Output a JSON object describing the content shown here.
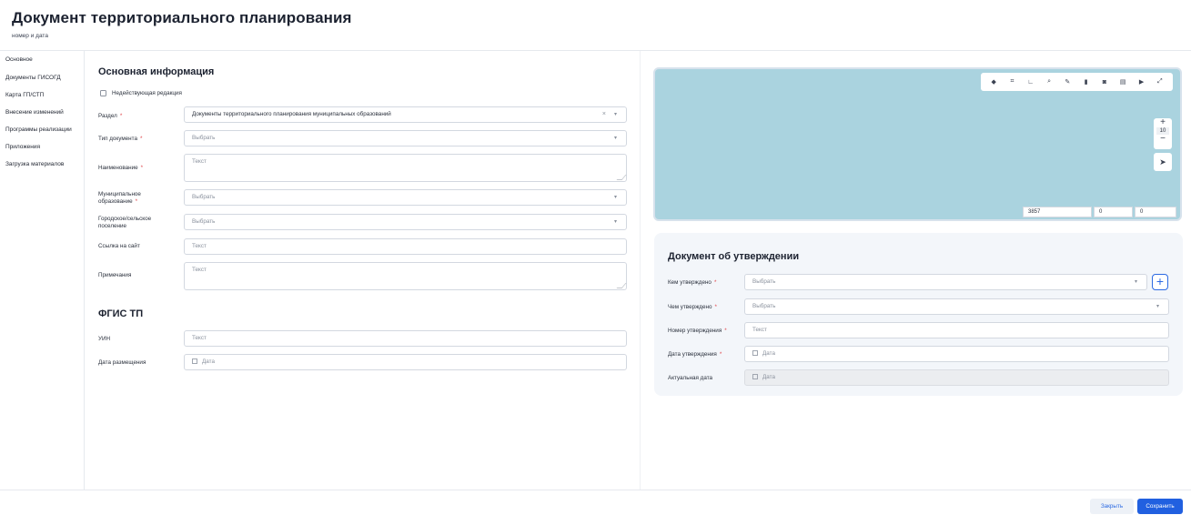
{
  "header": {
    "title": "Документ территориального планирования",
    "subtitle": "номер и дата"
  },
  "sidebar": {
    "items": [
      {
        "label": "Основное",
        "active": true
      },
      {
        "label": "Документы ГИСОГД"
      },
      {
        "label": "Карта ГП/СТП"
      },
      {
        "label": "Внесение изменений"
      },
      {
        "label": "Программы реализации"
      },
      {
        "label": "Приложения"
      },
      {
        "label": "Загрузка материалов"
      }
    ]
  },
  "main_info": {
    "title": "Основная информация",
    "invalid_edition_label": "Недействующая редакция",
    "fields": {
      "section": {
        "label": "Раздел",
        "required": "*",
        "value": "Документы территориального планирования муниципальных образований",
        "clear": "×",
        "chevron": "▾"
      },
      "doc_type": {
        "label": "Тип документа",
        "required": "*",
        "placeholder": "Выбрать",
        "chevron": "▾"
      },
      "name": {
        "label": "Наименование",
        "required": "*",
        "placeholder": "Текст"
      },
      "municipality": {
        "label": "Муниципальное образование",
        "required": "*",
        "placeholder": "Выбрать",
        "chevron": "▾"
      },
      "settlement": {
        "label": "Городское/сельское поселение",
        "placeholder": "Выбрать",
        "chevron": "▾"
      },
      "website": {
        "label": "Ссылка на сайт",
        "placeholder": "Текст"
      },
      "notes": {
        "label": "Примечания",
        "placeholder": "Текст"
      }
    }
  },
  "fgis": {
    "title": "ФГИС ТП",
    "uin": {
      "label": "УИН",
      "placeholder": "Текст"
    },
    "placement_date": {
      "label": "Дата размещения",
      "placeholder": "Дата"
    }
  },
  "map": {
    "background": "#aad3df",
    "tools": [
      "layers-icon",
      "frame-icon",
      "ruler-icon",
      "search-icon",
      "pencil-icon",
      "trash-icon",
      "camera-icon",
      "print-icon",
      "export-icon",
      "fullscreen-icon"
    ],
    "zoom_in": "+",
    "zoom_level": "10",
    "zoom_out": "−",
    "locate": "➤",
    "coords": [
      "3857",
      "0",
      "0"
    ]
  },
  "approval": {
    "title": "Документ об утверждении",
    "approved_by": {
      "label": "Кем утверждено",
      "required": "*",
      "placeholder": "Выбрать",
      "chevron": "▾"
    },
    "approved_with": {
      "label": "Чем утверждено",
      "required": "*",
      "placeholder": "Выбрать",
      "chevron": "▾"
    },
    "approval_number": {
      "label": "Номер утверждения",
      "required": "*",
      "placeholder": "Текст"
    },
    "approval_date": {
      "label": "Дата утверждения",
      "required": "*",
      "placeholder": "Дата"
    },
    "actual_date": {
      "label": "Актуальная дата",
      "placeholder": "Дата"
    },
    "add": "+"
  },
  "footer": {
    "close": "Закрыть",
    "save": "Сохранить"
  },
  "colors": {
    "accent": "#2160e0",
    "required": "#e0474c",
    "panel": "#f3f6fa"
  }
}
